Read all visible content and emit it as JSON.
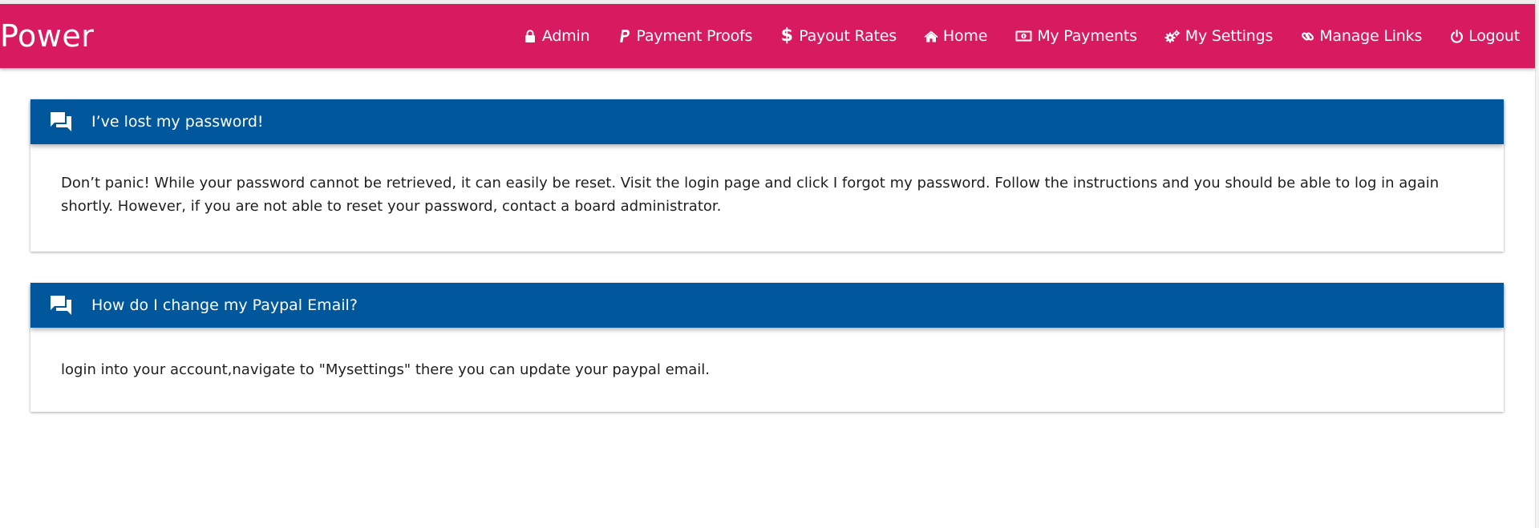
{
  "brand": {
    "name": "Power"
  },
  "colors": {
    "navbar": "#d81b60",
    "panel_header": "#01579b",
    "text": "#1f1f1f"
  },
  "nav": {
    "items": [
      {
        "label": "Admin",
        "icon": "lock-icon"
      },
      {
        "label": "Payment Proofs",
        "icon": "paypal-icon"
      },
      {
        "label": "Payout Rates",
        "icon": "dollar-icon"
      },
      {
        "label": "Home",
        "icon": "home-icon"
      },
      {
        "label": "My Payments",
        "icon": "money-icon"
      },
      {
        "label": "My Settings",
        "icon": "cogs-icon"
      },
      {
        "label": "Manage Links",
        "icon": "link-icon"
      },
      {
        "label": "Logout",
        "icon": "power-icon"
      }
    ]
  },
  "faqs": [
    {
      "icon": "chat-bubbles-icon",
      "question": "I’ve lost my password!",
      "answer": "Don’t panic! While your password cannot be retrieved, it can easily be reset. Visit the login page and click I forgot my password. Follow the instructions and you should be able to log in again shortly. However, if you are not able to reset your password, contact a board administrator."
    },
    {
      "icon": "chat-bubbles-icon",
      "question": "How do I change my Paypal Email?",
      "answer": "login into your account,navigate to \"Mysettings\" there you can update your paypal email."
    }
  ]
}
